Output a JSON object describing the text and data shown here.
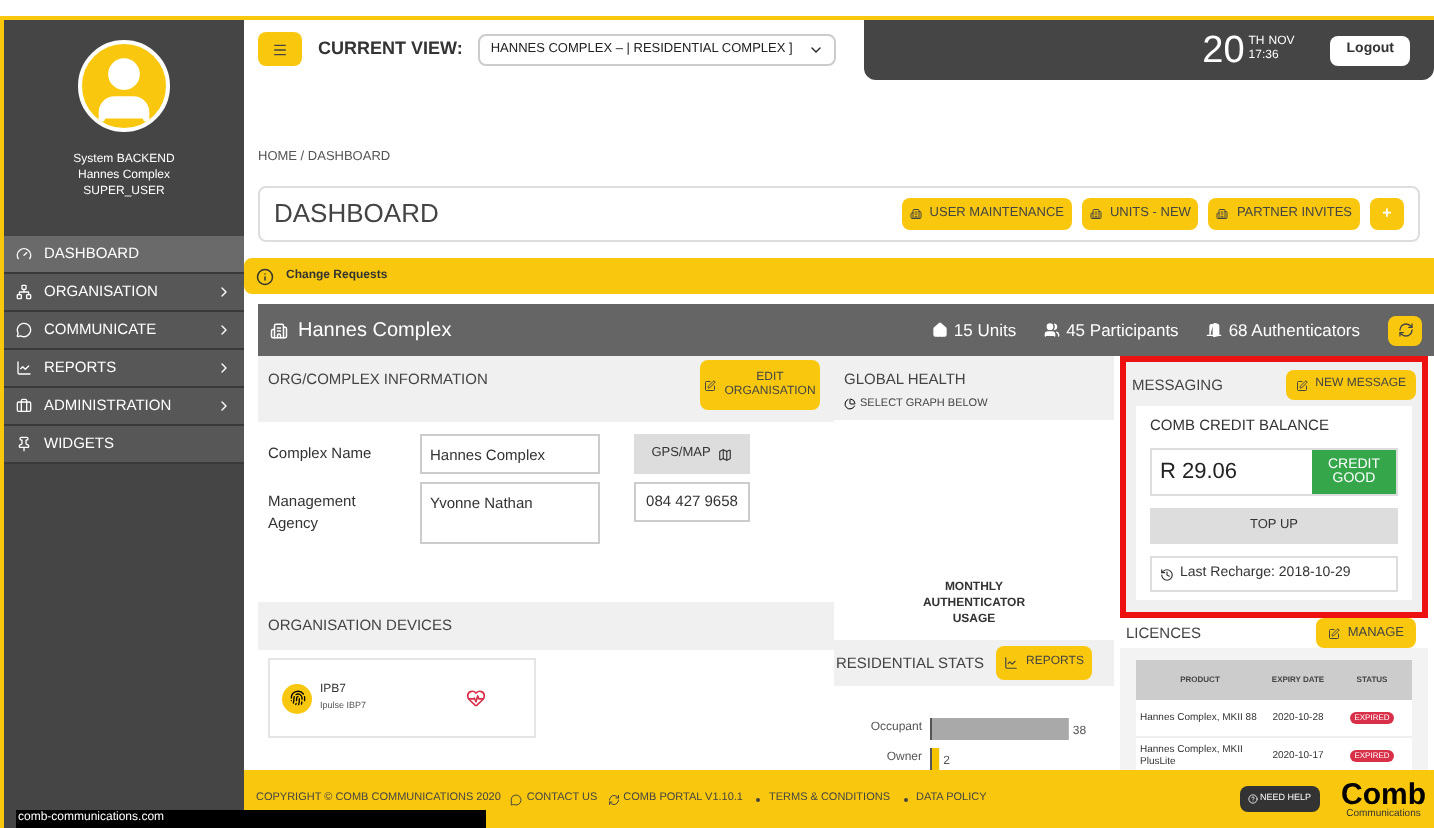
{
  "user": {
    "name": "System BACKEND",
    "complex": "Hannes Complex",
    "role": "SUPER_USER"
  },
  "sidebar": {
    "items": [
      {
        "label": "DASHBOARD",
        "selected": true,
        "has_submenu": false
      },
      {
        "label": "ORGANISATION",
        "selected": false,
        "has_submenu": true
      },
      {
        "label": "COMMUNICATE",
        "selected": false,
        "has_submenu": true
      },
      {
        "label": "REPORTS",
        "selected": false,
        "has_submenu": true
      },
      {
        "label": "ADMINISTRATION",
        "selected": false,
        "has_submenu": true
      },
      {
        "label": "WIDGETS",
        "selected": false,
        "has_submenu": false
      }
    ]
  },
  "header": {
    "current_view_label": "CURRENT VIEW:",
    "current_view_value": "HANNES COMPLEX – | RESIDENTIAL COMPLEX ]",
    "day": "20",
    "day_suffix": "TH",
    "month": "NOV",
    "time": "17:36",
    "logout": "Logout"
  },
  "breadcrumb": "HOME / DASHBOARD",
  "page_title": "DASHBOARD",
  "actions": [
    "USER MAINTENANCE",
    "UNITS - NEW",
    "PARTNER INVITES"
  ],
  "add_button": "+",
  "alert": "Change Requests",
  "complex": {
    "name": "Hannes Complex",
    "stats": [
      "15 Units",
      "45 Participants",
      "68 Authenticators"
    ]
  },
  "org_info": {
    "title": "ORG/COMPLEX INFORMATION",
    "edit_button": "EDIT ORGANISATION",
    "fields": [
      {
        "label": "Complex Name",
        "value": "Hannes Complex"
      },
      {
        "label": "Management Agency",
        "value": "Yvonne Nathan"
      }
    ],
    "gps_button": "GPS/MAP",
    "phone": "084 427 9658"
  },
  "devices": {
    "title": "ORGANISATION DEVICES",
    "items": [
      {
        "name": "IPB7",
        "model": "Ipulse IBP7"
      }
    ]
  },
  "global_health": {
    "title": "GLOBAL HEALTH",
    "subtitle": "SELECT GRAPH BELOW",
    "graph_label": "MONTHLY AUTHENTICATOR USAGE"
  },
  "residential_stats": {
    "title": "RESIDENTIAL STATS",
    "button": "REPORTS",
    "chart_data": {
      "type": "bar",
      "orientation": "horizontal",
      "categories": [
        "Occupant",
        "Owner"
      ],
      "stacked": true,
      "data_labels": true,
      "series": [
        {
          "color": "#a9a9a9",
          "values": [
            38,
            null
          ]
        },
        {
          "color": "#f5c400",
          "values": [
            null,
            2
          ]
        }
      ]
    }
  },
  "messaging": {
    "title": "MESSAGING",
    "new_message": "NEW MESSAGE",
    "highlighted": true,
    "balance_title": "COMB CREDIT BALANCE",
    "balance": "R 29.06",
    "credit_status": "CREDIT GOOD",
    "top_up": "TOP UP",
    "last_recharge": "Last Recharge: 2018-10-29"
  },
  "licences": {
    "title": "LICENCES",
    "manage": "MANAGE",
    "columns": [
      "PRODUCT",
      "EXPIRY DATE",
      "STATUS"
    ],
    "rows": [
      {
        "product": "Hannes Complex, MKII 88",
        "expiry": "2020-10-28",
        "status": "EXPIRED"
      },
      {
        "product": "Hannes Complex, MKII PlusLite",
        "expiry": "2020-10-17",
        "status": "EXPIRED"
      }
    ]
  },
  "footer": {
    "links": [
      "COPYRIGHT © COMB COMMUNICATIONS 2020",
      "CONTACT US",
      "COMB PORTAL V1.10.1",
      "TERMS & CONDITIONS",
      "DATA POLICY"
    ],
    "help": "NEED HELP",
    "logo": "Comb",
    "logo_sub": "Communications"
  },
  "status_url": "comb-communications.com"
}
